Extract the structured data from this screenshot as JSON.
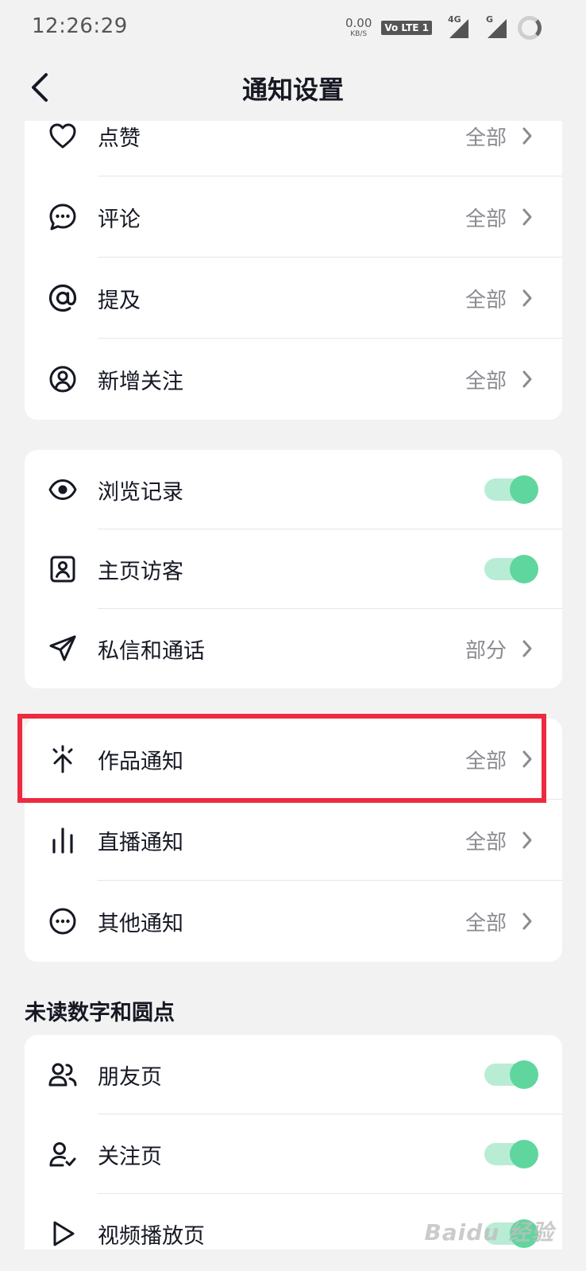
{
  "status_bar": {
    "time": "12:26:29",
    "net_speed_value": "0.00",
    "net_speed_unit": "KB/S",
    "volte_badge": "Vo LTE 1",
    "signal_1_label": "4G",
    "signal_2_label": "G"
  },
  "header": {
    "title": "通知设置"
  },
  "interaction_card": {
    "rows": [
      {
        "label": "点赞",
        "value": "全部",
        "icon": "heart-icon"
      },
      {
        "label": "评论",
        "value": "全部",
        "icon": "comment-icon"
      },
      {
        "label": "提及",
        "value": "全部",
        "icon": "at-icon"
      },
      {
        "label": "新增关注",
        "value": "全部",
        "icon": "user-circle-icon"
      }
    ]
  },
  "privacy_card": {
    "rows": [
      {
        "label": "浏览记录",
        "toggle_on": true,
        "icon": "eye-icon"
      },
      {
        "label": "主页访客",
        "toggle_on": true,
        "icon": "profile-icon"
      },
      {
        "label": "私信和通话",
        "value": "部分",
        "icon": "send-icon"
      }
    ]
  },
  "content_card": {
    "rows": [
      {
        "label": "作品通知",
        "value": "全部",
        "icon": "sparkle-arrow-icon"
      },
      {
        "label": "直播通知",
        "value": "全部",
        "icon": "bars-icon"
      },
      {
        "label": "其他通知",
        "value": "全部",
        "icon": "more-circle-icon"
      }
    ]
  },
  "unread_section": {
    "title": "未读数字和圆点",
    "rows": [
      {
        "label": "朋友页",
        "toggle_on": true,
        "icon": "friends-icon"
      },
      {
        "label": "关注页",
        "toggle_on": true,
        "icon": "following-icon"
      },
      {
        "label": "视频播放页",
        "toggle_on": true,
        "icon": "play-icon"
      }
    ]
  },
  "highlight_color": "#ee2a3f",
  "accent_color": "#5fd69d",
  "watermark_text": "Baidu 经验"
}
